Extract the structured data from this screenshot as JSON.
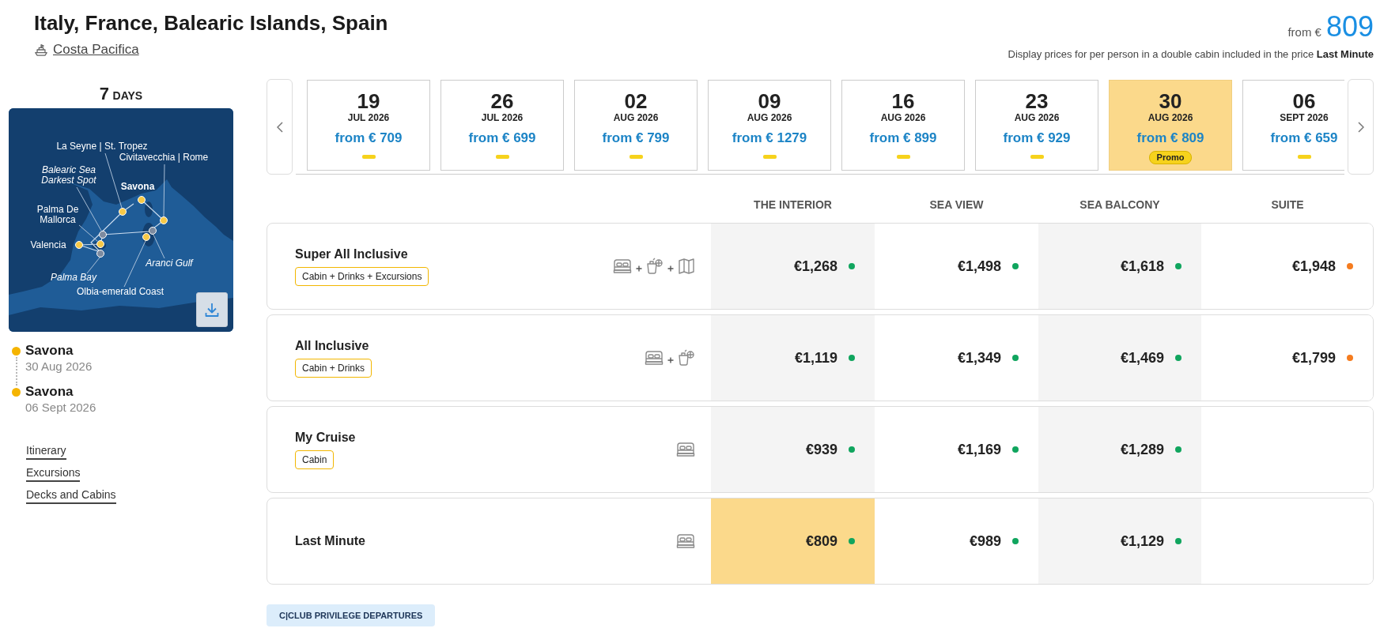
{
  "header": {
    "title": "Italy, France, Balearic Islands, Spain",
    "ship": "Costa Pacifica"
  },
  "price_summary": {
    "from_label": "from €",
    "price": "809",
    "note": "Display prices for per person in a double cabin included in the price **Last Minute**"
  },
  "sidebar": {
    "duration": {
      "number": "7",
      "unit": "DAYS"
    },
    "map": {
      "labels": [
        {
          "lines": [
            "La Seyne | St. Tropez"
          ],
          "kind": "port"
        },
        {
          "lines": [
            "Civitavecchia | Rome"
          ],
          "kind": "port"
        },
        {
          "lines": [
            "Balearic Sea",
            "Darkest Spot"
          ],
          "kind": "scenic"
        },
        {
          "lines": [
            "Savona"
          ],
          "kind": "home"
        },
        {
          "lines": [
            "Palma De",
            "Mallorca"
          ],
          "kind": "port"
        },
        {
          "lines": [
            "Valencia"
          ],
          "kind": "port"
        },
        {
          "lines": [
            "Aranci Gulf"
          ],
          "kind": "scenic"
        },
        {
          "lines": [
            "Palma Bay"
          ],
          "kind": "scenic"
        },
        {
          "lines": [
            "Olbia-emerald Coast"
          ],
          "kind": "port"
        }
      ]
    },
    "itinerary": [
      {
        "port": "Savona",
        "date": "30 Aug 2026"
      },
      {
        "port": "Savona",
        "date": "06 Sept 2026"
      }
    ],
    "links": [
      "Itinerary",
      "Excursions",
      "Decks and Cabins"
    ]
  },
  "departures": [
    {
      "day": "19",
      "month": "JUL 2026",
      "price": "from € 709",
      "selected": false
    },
    {
      "day": "26",
      "month": "JUL 2026",
      "price": "from € 699",
      "selected": false
    },
    {
      "day": "02",
      "month": "AUG 2026",
      "price": "from € 799",
      "selected": false
    },
    {
      "day": "09",
      "month": "AUG 2026",
      "price": "from € 1279",
      "selected": false
    },
    {
      "day": "16",
      "month": "AUG 2026",
      "price": "from € 899",
      "selected": false
    },
    {
      "day": "23",
      "month": "AUG 2026",
      "price": "from € 929",
      "selected": false
    },
    {
      "day": "30",
      "month": "AUG 2026",
      "price": "from € 809",
      "selected": true,
      "badge": "Promo"
    },
    {
      "day": "06",
      "month": "SEPT 2026",
      "price": "from € 659",
      "selected": false
    }
  ],
  "fares": {
    "columns": [
      "THE INTERIOR",
      "SEA VIEW",
      "SEA BALCONY",
      "SUITE"
    ],
    "rows": [
      {
        "name": "Super All Inclusive",
        "tag": "Cabin + Drinks + Excursions",
        "includes": [
          {
            "kind": "cabin"
          },
          {
            "kind": "drinks"
          },
          {
            "kind": "excursions"
          }
        ],
        "prices": [
          {
            "price": "€1,268",
            "color": "#10a55e",
            "selected": false
          },
          {
            "price": "€1,498",
            "color": "#10a55e",
            "selected": false
          },
          {
            "price": "€1,618",
            "color": "#10a55e",
            "selected": false
          },
          {
            "price": "€1,948",
            "color": "#f57c1f",
            "selected": false
          }
        ]
      },
      {
        "name": "All Inclusive",
        "tag": "Cabin + Drinks",
        "includes": [
          {
            "kind": "cabin"
          },
          {
            "kind": "drinks"
          }
        ],
        "prices": [
          {
            "price": "€1,119",
            "color": "#10a55e",
            "selected": false
          },
          {
            "price": "€1,349",
            "color": "#10a55e",
            "selected": false
          },
          {
            "price": "€1,469",
            "color": "#10a55e",
            "selected": false
          },
          {
            "price": "€1,799",
            "color": "#f57c1f",
            "selected": false
          }
        ]
      },
      {
        "name": "My Cruise",
        "tag": "Cabin",
        "includes": [
          {
            "kind": "cabin"
          }
        ],
        "prices": [
          {
            "price": "€939",
            "color": "#10a55e",
            "selected": false
          },
          {
            "price": "€1,169",
            "color": "#10a55e",
            "selected": false
          },
          {
            "price": "€1,289",
            "color": "#10a55e",
            "selected": false
          }
        ]
      },
      {
        "name": "Last Minute",
        "includes": [
          {
            "kind": "cabin"
          }
        ],
        "prices": [
          {
            "price": "€809",
            "color": "#10a55e",
            "selected": true
          },
          {
            "price": "€989",
            "color": "#10a55e",
            "selected": false
          },
          {
            "price": "€1,129",
            "color": "#10a55e",
            "selected": false
          }
        ]
      }
    ]
  },
  "footer_badge": "C|CLUB PRIVILEGE DEPARTURES"
}
